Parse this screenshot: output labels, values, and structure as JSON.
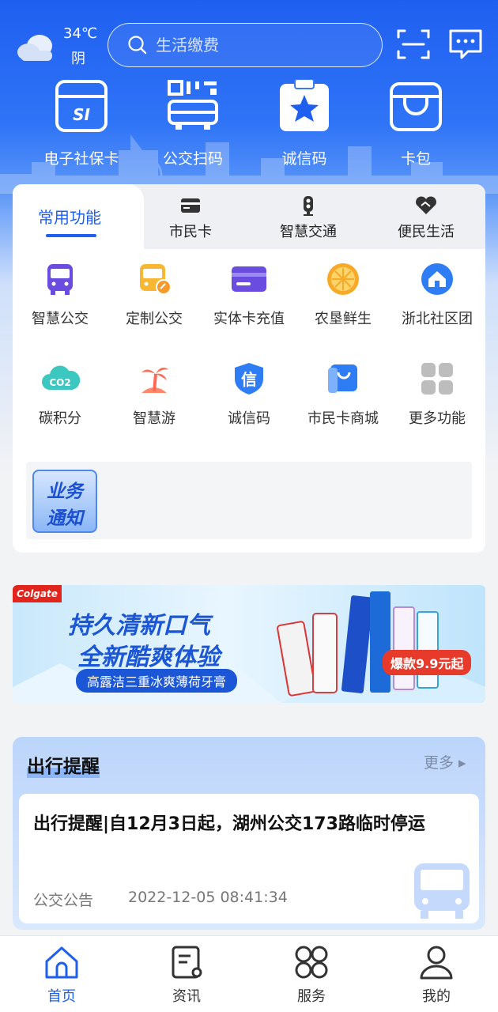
{
  "weather": {
    "temperature": "34℃",
    "condition": "阴"
  },
  "search": {
    "placeholder": "生活缴费"
  },
  "quick_actions": [
    {
      "label": "电子社保卡",
      "icon": "social-security-card-icon"
    },
    {
      "label": "公交扫码",
      "icon": "bus-scan-icon"
    },
    {
      "label": "诚信码",
      "icon": "credit-code-icon"
    },
    {
      "label": "卡包",
      "icon": "card-wallet-icon"
    }
  ],
  "tabs": [
    {
      "label": "常用功能",
      "active": true
    },
    {
      "label": "市民卡",
      "icon": "citizen-card-icon"
    },
    {
      "label": "智慧交通",
      "icon": "traffic-light-icon"
    },
    {
      "label": "便民生活",
      "icon": "handshake-icon"
    }
  ],
  "functions": [
    {
      "label": "智慧公交",
      "icon": "bus-icon"
    },
    {
      "label": "定制公交",
      "icon": "custom-bus-icon"
    },
    {
      "label": "实体卡充值",
      "icon": "card-recharge-icon"
    },
    {
      "label": "农垦鲜生",
      "icon": "orange-icon"
    },
    {
      "label": "浙北社区团",
      "icon": "community-icon"
    },
    {
      "label": "碳积分",
      "icon": "carbon-cloud-icon"
    },
    {
      "label": "智慧游",
      "icon": "palm-tree-icon"
    },
    {
      "label": "诚信码",
      "icon": "credit-shield-icon"
    },
    {
      "label": "市民卡商城",
      "icon": "shopping-bag-icon"
    },
    {
      "label": "更多功能",
      "icon": "more-grid-icon"
    }
  ],
  "notice": {
    "badge_line1": "业务",
    "badge_line2": "通知"
  },
  "ad": {
    "brand": "Colgate",
    "headline1": "持久清新口气",
    "headline2": "全新酷爽体验",
    "subline": "高露洁三重冰爽薄荷牙膏",
    "price_tag": "爆款9.9元起"
  },
  "travel": {
    "title": "出行提醒",
    "more": "更多 ▸",
    "headline": "出行提醒|自12月3日起，湖州公交173路临时停运",
    "category": "公交公告",
    "time": "2022-12-05 08:41:34"
  },
  "bottom_nav": [
    {
      "label": "首页",
      "icon": "home-icon",
      "active": true
    },
    {
      "label": "资讯",
      "icon": "news-icon"
    },
    {
      "label": "服务",
      "icon": "services-icon"
    },
    {
      "label": "我的",
      "icon": "profile-icon"
    }
  ],
  "colors": {
    "primary": "#1f5ff0",
    "accent_red": "#e83a2a"
  }
}
